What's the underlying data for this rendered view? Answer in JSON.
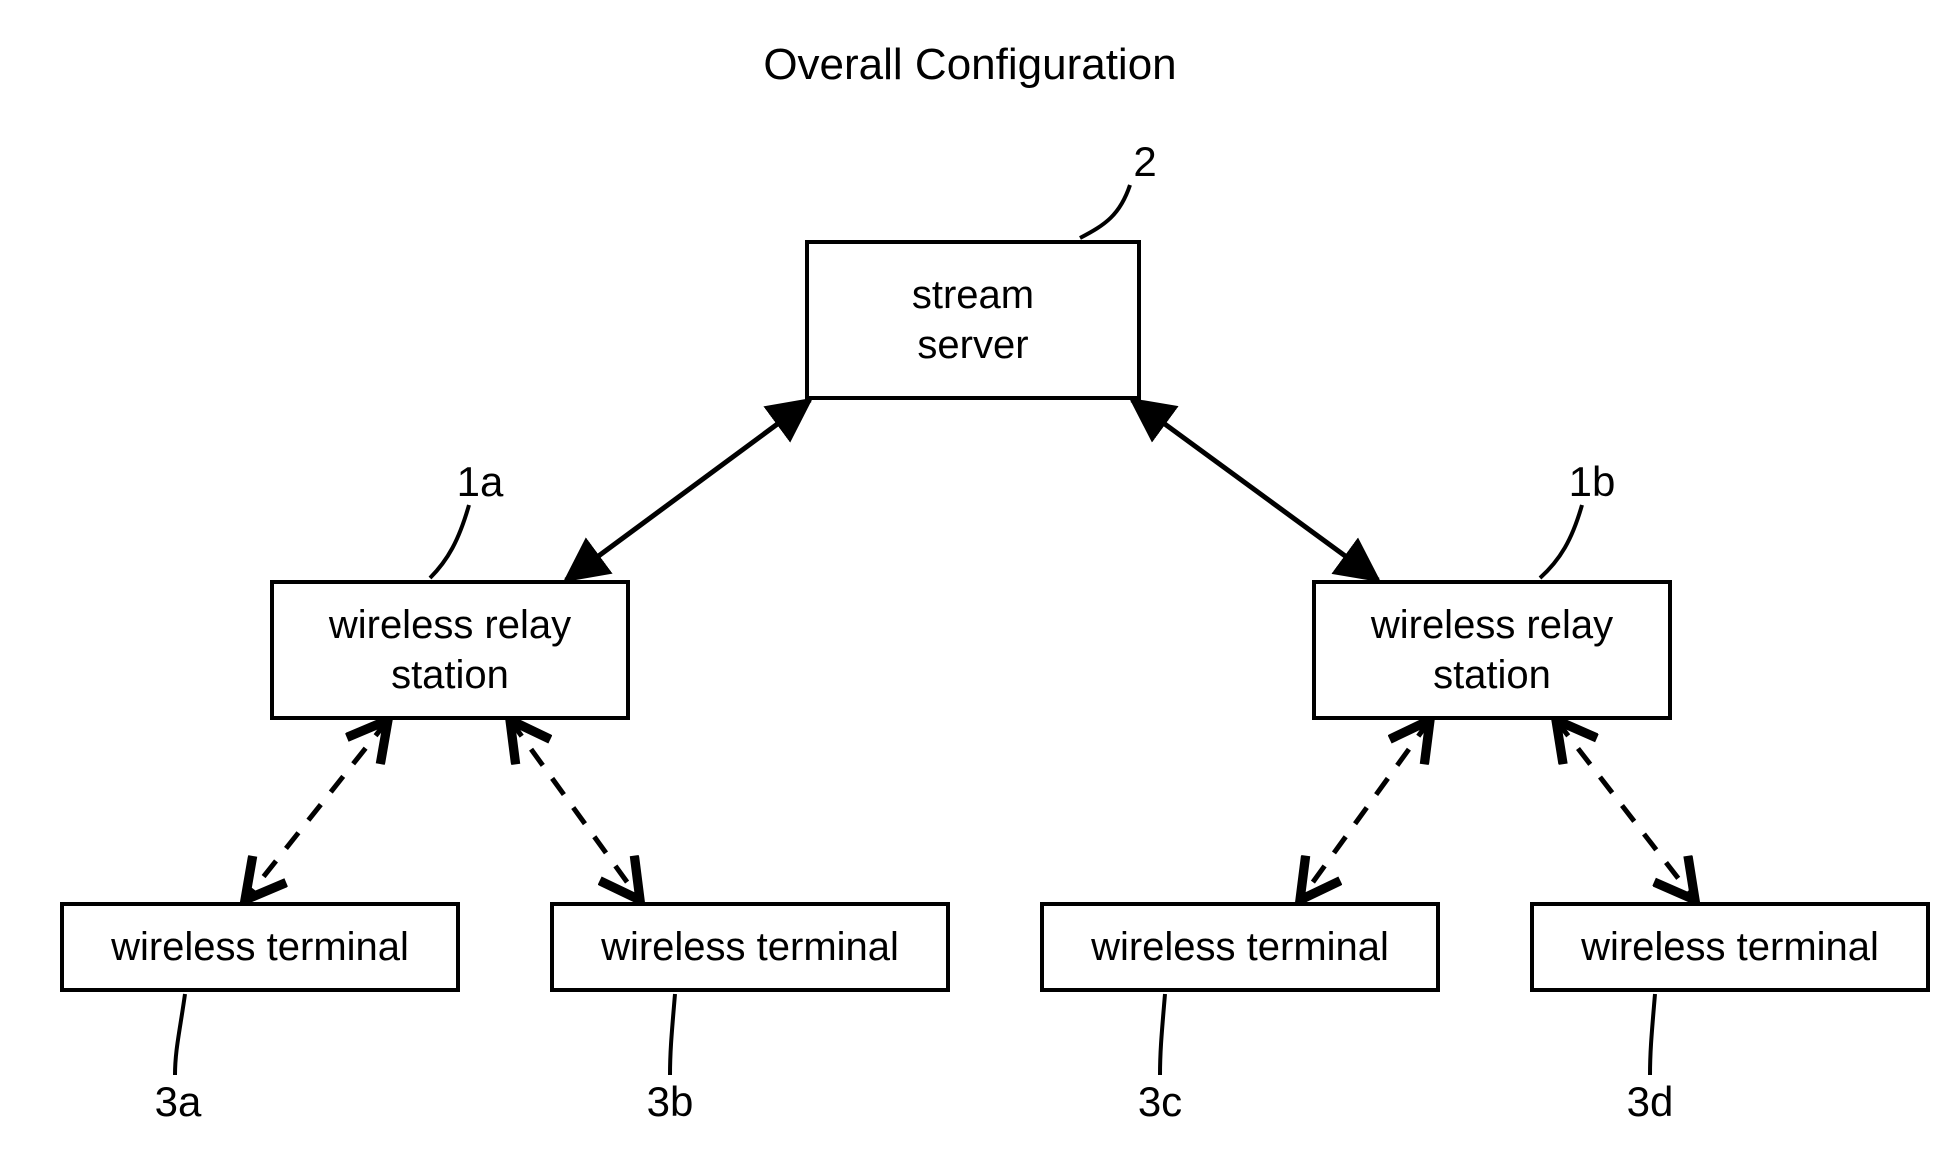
{
  "title": "Overall Configuration",
  "nodes": {
    "server": {
      "text": "stream\nserver"
    },
    "relay_a": {
      "text": "wireless relay\nstation"
    },
    "relay_b": {
      "text": "wireless relay\nstation"
    },
    "term_a": {
      "text": "wireless terminal"
    },
    "term_b": {
      "text": "wireless terminal"
    },
    "term_c": {
      "text": "wireless terminal"
    },
    "term_d": {
      "text": "wireless terminal"
    }
  },
  "labels": {
    "server": "2",
    "relay_a": "1a",
    "relay_b": "1b",
    "term_a": "3a",
    "term_b": "3b",
    "term_c": "3c",
    "term_d": "3d"
  }
}
